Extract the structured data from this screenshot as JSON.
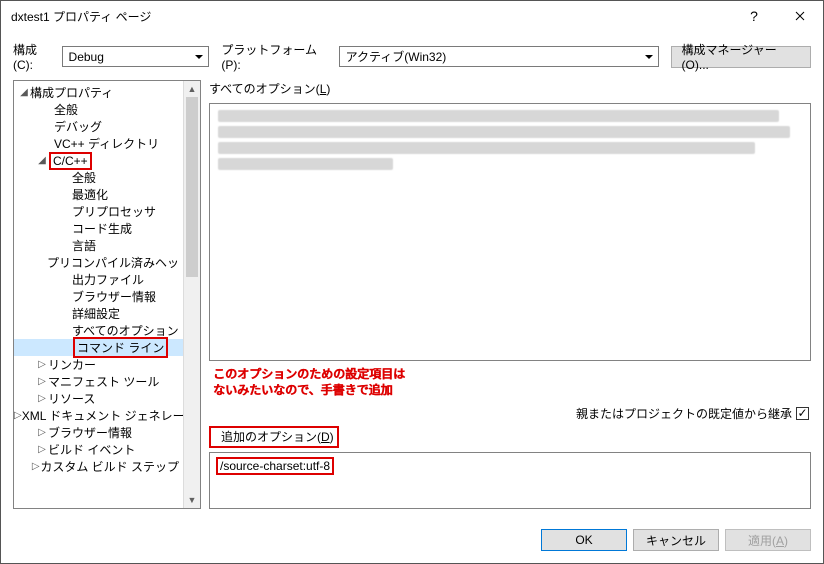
{
  "title": "dxtest1 プロパティ ページ",
  "toolbar": {
    "config_label": "構成(C):",
    "config_value": "Debug",
    "platform_label": "プラットフォーム(P):",
    "platform_value": "アクティブ(Win32)",
    "manager_label": "構成マネージャー(O)..."
  },
  "tree": {
    "root": "構成プロパティ",
    "items": [
      "全般",
      "デバッグ",
      "VC++ ディレクトリ"
    ],
    "cpp": "C/C++",
    "cpp_items": [
      "全般",
      "最適化",
      "プリプロセッサ",
      "コード生成",
      "言語",
      "プリコンパイル済みヘッ",
      "出力ファイル",
      "ブラウザー情報",
      "詳細設定",
      "すべてのオプション",
      "コマンド ライン"
    ],
    "after": [
      "リンカー",
      "マニフェスト ツール",
      "リソース",
      "XML ドキュメント ジェネレー",
      "ブラウザー情報",
      "ビルド イベント",
      "カスタム ビルド ステップ"
    ]
  },
  "right": {
    "all_options_label": "すべてのオプション(L)",
    "annotation_line1": "このオプションのための設定項目は",
    "annotation_line2": "ないみたいなので、手書きで追加",
    "inherit_label": "親またはプロジェクトの既定値から継承",
    "inherit_checked": "✓",
    "additional_label": "追加のオプション(D)",
    "additional_value": "/source-charset:utf-8"
  },
  "footer": {
    "ok": "OK",
    "cancel": "キャンセル",
    "apply": "適用(A)"
  }
}
